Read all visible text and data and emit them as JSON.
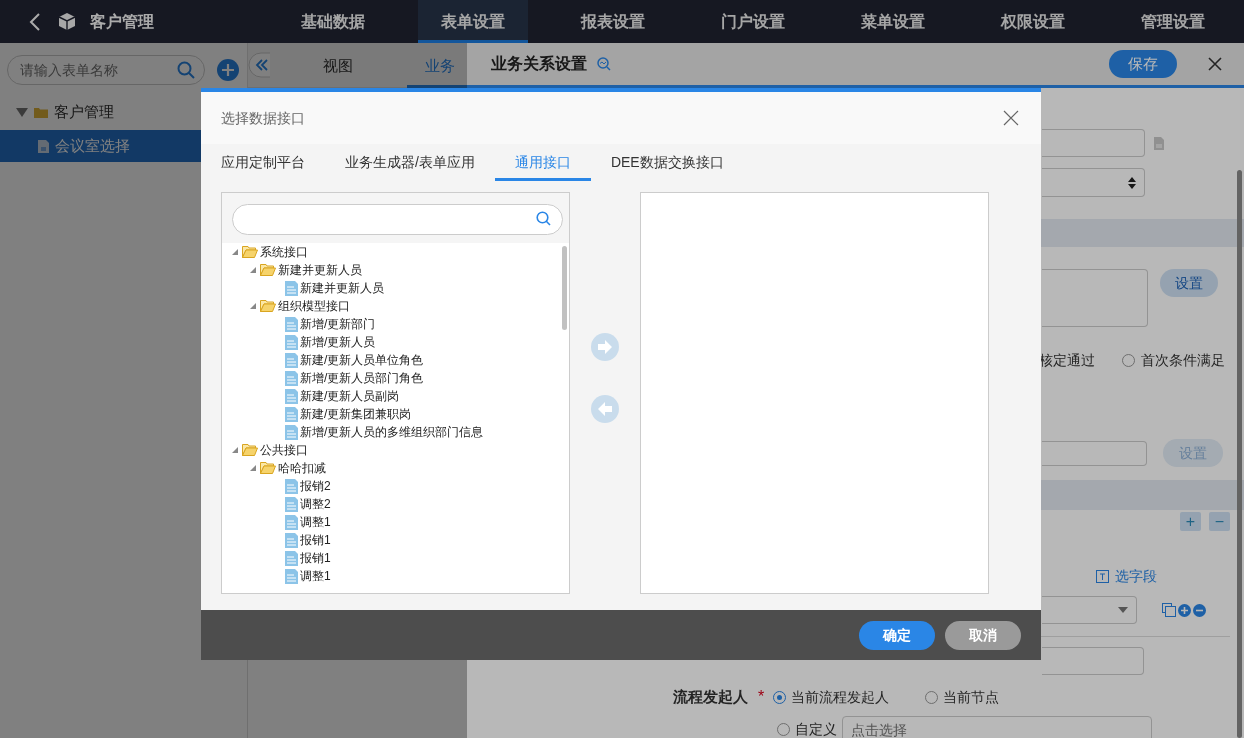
{
  "top_bar": {
    "title": "客户管理",
    "nav": [
      {
        "label": "基础数据",
        "selected": false
      },
      {
        "label": "表单设置",
        "selected": true
      },
      {
        "label": "报表设置",
        "selected": false
      },
      {
        "label": "门户设置",
        "selected": false
      },
      {
        "label": "菜单设置",
        "selected": false
      },
      {
        "label": "权限设置",
        "selected": false
      },
      {
        "label": "管理设置",
        "selected": false
      }
    ]
  },
  "sidebar": {
    "search": {
      "placeholder": "请输入表单名称"
    },
    "tree": [
      {
        "label": "客户管理",
        "kind": "folder",
        "expanded": true,
        "selected": false,
        "children": [
          {
            "label": "会议室选择",
            "kind": "form",
            "selected": true
          }
        ]
      }
    ]
  },
  "main_tabs": [
    {
      "label": "视图",
      "selected": false
    },
    {
      "label": "业务",
      "selected": true
    }
  ],
  "drawer": {
    "title": "业务关系设置",
    "save_button": "保存",
    "condition_text": "核定通过",
    "condition_option": {
      "label": "首次条件满足",
      "selected": false
    },
    "set_buttons": [
      {
        "label": "设置",
        "disabled": false
      },
      {
        "label": "设置",
        "disabled": true
      }
    ],
    "row_buttons": [
      "+",
      "−"
    ],
    "field_picker": "选字段",
    "initiator": {
      "label": "流程发起人",
      "required_mark": "*",
      "options": [
        {
          "label": "当前流程发起人",
          "selected": true
        },
        {
          "label": "当前节点",
          "selected": false
        },
        {
          "label": "自定义",
          "selected": false
        }
      ],
      "custom_placeholder": "点击选择"
    }
  },
  "modal": {
    "title": "选择数据接口",
    "tabs": [
      {
        "label": "应用定制平台",
        "selected": false
      },
      {
        "label": "业务生成器/表单应用",
        "selected": false
      },
      {
        "label": "通用接口",
        "selected": true
      },
      {
        "label": "DEE数据交换接口",
        "selected": false
      }
    ],
    "tree": [
      {
        "label": "系统接口",
        "kind": "folder",
        "expanded": true,
        "children": [
          {
            "label": "新建并更新人员",
            "kind": "folder",
            "expanded": true,
            "children": [
              {
                "label": "新建并更新人员",
                "kind": "file"
              }
            ]
          },
          {
            "label": "组织模型接口",
            "kind": "folder",
            "expanded": true,
            "children": [
              {
                "label": "新增/更新部门",
                "kind": "file"
              },
              {
                "label": "新增/更新人员",
                "kind": "file"
              },
              {
                "label": "新建/更新人员单位角色",
                "kind": "file"
              },
              {
                "label": "新增/更新人员部门角色",
                "kind": "file"
              },
              {
                "label": "新建/更新人员副岗",
                "kind": "file"
              },
              {
                "label": "新建/更新集团兼职岗",
                "kind": "file"
              },
              {
                "label": "新增/更新人员的多维组织部门信息",
                "kind": "file"
              }
            ]
          }
        ]
      },
      {
        "label": "公共接口",
        "kind": "folder",
        "expanded": true,
        "children": [
          {
            "label": "哈哈扣减",
            "kind": "folder",
            "expanded": true,
            "children": [
              {
                "label": "报销2",
                "kind": "file"
              },
              {
                "label": "调整2",
                "kind": "file"
              },
              {
                "label": "调整1",
                "kind": "file"
              },
              {
                "label": "报销1",
                "kind": "file"
              },
              {
                "label": "报销1",
                "kind": "file"
              },
              {
                "label": "调整1",
                "kind": "file"
              }
            ]
          }
        ]
      }
    ],
    "buttons": [
      {
        "label": "确定",
        "kind": "primary"
      },
      {
        "label": "取消",
        "kind": "secondary"
      }
    ]
  }
}
